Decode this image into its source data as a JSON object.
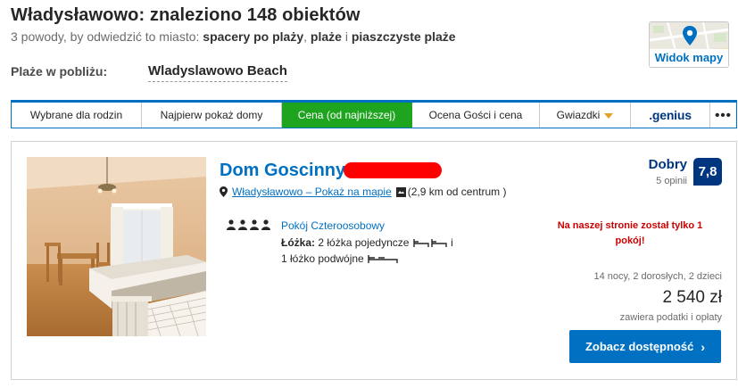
{
  "header": {
    "title": "Władysławowo: znaleziono 148 obiektów",
    "subtitle_prefix": "3 powody, by odwiedzić to miasto:",
    "reasons": [
      "spacery po plaży",
      "plaże",
      "piaszczyste plaże"
    ],
    "sep_1": ",",
    "sep_2": "i"
  },
  "map_button": {
    "label": "Widok mapy",
    "icon": "map-pin-icon"
  },
  "beaches": {
    "label": "Plaże w pobliżu:",
    "beach": "Wladyslawowo Beach"
  },
  "sort_tabs": [
    {
      "label": "Wybrane dla rodzin",
      "active": false
    },
    {
      "label": "Najpierw pokaż domy",
      "active": false
    },
    {
      "label": "Cena (od najniższej)",
      "active": true
    },
    {
      "label": "Ocena Gości i cena",
      "active": false
    },
    {
      "label": "Gwiazdki",
      "active": false
    },
    {
      "label": ".genius",
      "active": false
    },
    {
      "label": "•••",
      "active": false
    }
  ],
  "property": {
    "name": "Dom Goscinny",
    "location_link": "Władysławowo – Pokaż na mapie",
    "distance": "(2,9 km od centrum )",
    "score_label": "Dobry",
    "reviews": "5 opinii",
    "score": "7,8",
    "room_type": "Pokój Czteroosobowy",
    "beds_label": "Łóżka:",
    "beds_line1": "2 łóżka pojedyncze",
    "beds_conj": "i",
    "beds_line2": "1 łóżko podwójne",
    "scarcity": "Na naszej stronie został tylko 1 pokój!",
    "stay_info": "14 nocy, 2 dorosłych, 2 dzieci",
    "price": "2 540 zł",
    "taxes": "zawiera podatki i opłaty",
    "cta": "Zobacz dostępność",
    "cta_chevron": "›"
  },
  "colors": {
    "brand_blue": "#0071c2",
    "dark_blue": "#003580",
    "active_green": "#1ea41e",
    "alert_red": "#cc0000"
  }
}
